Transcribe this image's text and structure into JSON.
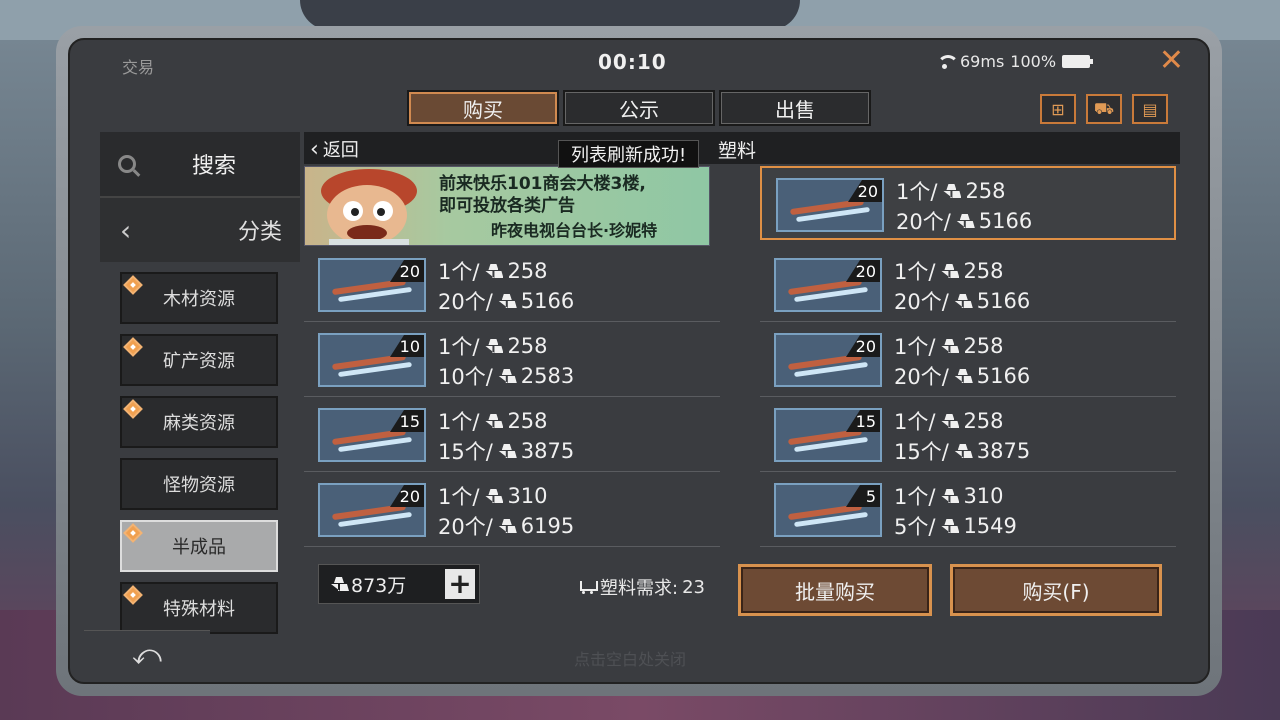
{
  "header": {
    "title": "交易",
    "clock": "00:10",
    "ping": "69ms",
    "battery": "100%"
  },
  "tabs": [
    {
      "label": "购买",
      "active": true
    },
    {
      "label": "公示",
      "active": false
    },
    {
      "label": "出售",
      "active": false
    }
  ],
  "top_icons": [
    "hierarchy-icon",
    "cart-icon",
    "clipboard-icon"
  ],
  "sidebar": {
    "search_label": "搜索",
    "category_label": "分类",
    "items": [
      {
        "label": "木材资源",
        "marked": true,
        "selected": false
      },
      {
        "label": "矿产资源",
        "marked": true,
        "selected": false
      },
      {
        "label": "麻类资源",
        "marked": true,
        "selected": false
      },
      {
        "label": "怪物资源",
        "marked": false,
        "selected": false
      },
      {
        "label": "半成品",
        "marked": true,
        "selected": true
      },
      {
        "label": "特殊材料",
        "marked": true,
        "selected": false
      }
    ]
  },
  "subbar": {
    "back_label": "返回",
    "category_title": "塑料",
    "toast": "列表刷新成功!"
  },
  "ad": {
    "line1": "前来快乐101商会大楼3楼,",
    "line2": "即可投放各类广告",
    "line3": "昨夜电视台台长·珍妮特"
  },
  "listings": [
    {
      "qty": "20",
      "unit": "1个/",
      "unit_price": "258",
      "bulk": "20个/",
      "total": "5166",
      "highlight": true,
      "col": 1,
      "row": 0
    },
    {
      "qty": "20",
      "unit": "1个/",
      "unit_price": "258",
      "bulk": "20个/",
      "total": "5166",
      "highlight": false,
      "col": 0,
      "row": 1
    },
    {
      "qty": "20",
      "unit": "1个/",
      "unit_price": "258",
      "bulk": "20个/",
      "total": "5166",
      "highlight": false,
      "col": 1,
      "row": 1
    },
    {
      "qty": "10",
      "unit": "1个/",
      "unit_price": "258",
      "bulk": "10个/",
      "total": "2583",
      "highlight": false,
      "col": 0,
      "row": 2
    },
    {
      "qty": "20",
      "unit": "1个/",
      "unit_price": "258",
      "bulk": "20个/",
      "total": "5166",
      "highlight": false,
      "col": 1,
      "row": 2
    },
    {
      "qty": "15",
      "unit": "1个/",
      "unit_price": "258",
      "bulk": "15个/",
      "total": "3875",
      "highlight": false,
      "col": 0,
      "row": 3
    },
    {
      "qty": "15",
      "unit": "1个/",
      "unit_price": "258",
      "bulk": "15个/",
      "total": "3875",
      "highlight": false,
      "col": 1,
      "row": 3
    },
    {
      "qty": "20",
      "unit": "1个/",
      "unit_price": "310",
      "bulk": "20个/",
      "total": "6195",
      "highlight": false,
      "col": 0,
      "row": 4
    },
    {
      "qty": "5",
      "unit": "1个/",
      "unit_price": "310",
      "bulk": "5个/",
      "total": "1549",
      "highlight": false,
      "col": 1,
      "row": 4
    }
  ],
  "footer": {
    "money": "873万",
    "demand_label": "塑料需求:",
    "demand_value": "23",
    "bulk_buy_label": "批量购买",
    "buy_label": "购买(F)",
    "hint": "点击空白处关闭"
  },
  "colors": {
    "accent": "#d8924e",
    "active_tab": "#6a4a34",
    "panel": "#3a3c40"
  }
}
